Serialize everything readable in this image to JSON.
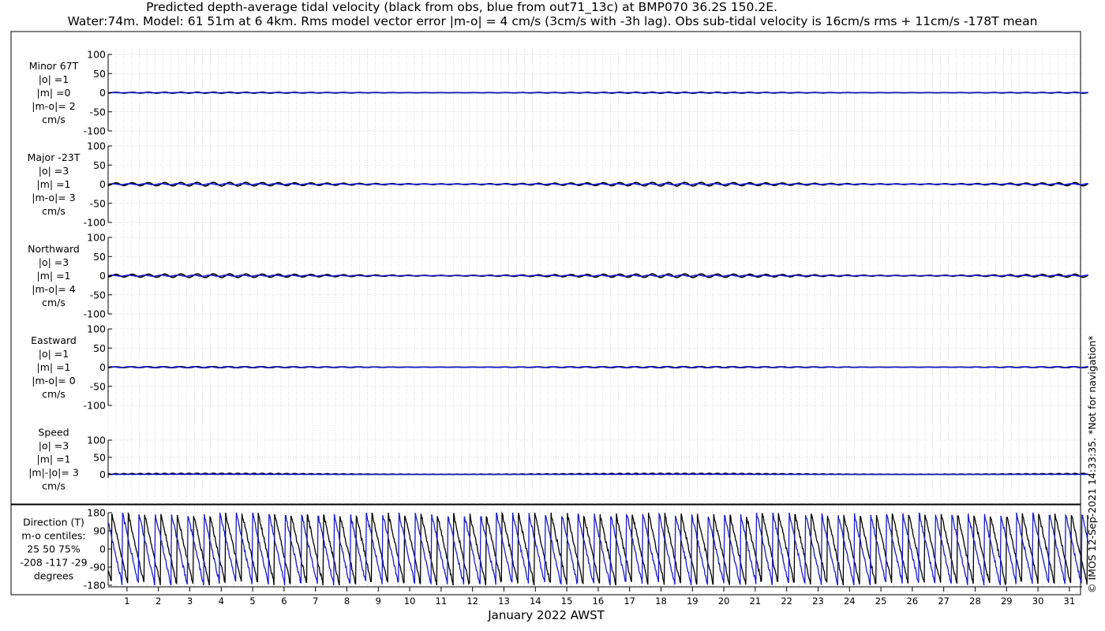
{
  "title_line1": "Predicted depth-average tidal velocity (black from obs, blue from out71_13c) at BMP070 36.2S 150.2E.",
  "title_line2": "Water:74m. Model: 61 51m at 6 4km. Rms model vector error |m-o| = 4 cm/s (3cm/s with -3h lag). Obs sub-tidal velocity is 16cm/s rms + 11cm/s -178T mean",
  "xlabel": "January 2022 AWST",
  "copyright": "© IMOS 12-Sep-2021 14:33:35. *Not for navigation*",
  "colors": {
    "obs": "#000000",
    "model": "#1a1acc",
    "grid": "#bbbbbb",
    "axis": "#000000"
  },
  "chart_data": {
    "type": "line",
    "x_days": [
      "1",
      "2",
      "3",
      "4",
      "5",
      "6",
      "7",
      "8",
      "9",
      "10",
      "11",
      "12",
      "13",
      "14",
      "15",
      "16",
      "17",
      "18",
      "19",
      "20",
      "21",
      "22",
      "23",
      "24",
      "25",
      "26",
      "27",
      "28",
      "29",
      "30",
      "31"
    ],
    "series_legend": [
      "obs (black)",
      "model (blue)"
    ],
    "panels": [
      {
        "id": "minor",
        "label_lines": [
          "Minor 67T",
          "|o| =1",
          "|m| =0",
          "|m-o|= 2",
          "cm/s"
        ],
        "yticks": [
          "100",
          "50",
          "0",
          "-50",
          "-100"
        ],
        "ylim": [
          -100,
          100
        ],
        "obs_amplitude": 1,
        "model_amplitude": 0
      },
      {
        "id": "major",
        "label_lines": [
          "Major -23T",
          "|o| =3",
          "|m| =1",
          "|m-o|= 3",
          "cm/s"
        ],
        "yticks": [
          "100",
          "50",
          "0",
          "-50",
          "-100"
        ],
        "ylim": [
          -100,
          100
        ],
        "obs_amplitude": 3,
        "model_amplitude": 1
      },
      {
        "id": "northward",
        "label_lines": [
          "Northward",
          "|o| =3",
          "|m| =1",
          "|m-o|= 4",
          "cm/s"
        ],
        "yticks": [
          "100",
          "50",
          "0",
          "-50",
          "-100"
        ],
        "ylim": [
          -100,
          100
        ],
        "obs_amplitude": 3,
        "model_amplitude": 1
      },
      {
        "id": "eastward",
        "label_lines": [
          "Eastward",
          "|o| =1",
          "|m| =1",
          "|m-o|= 0",
          "cm/s"
        ],
        "yticks": [
          "100",
          "50",
          "0",
          "-50",
          "-100"
        ],
        "ylim": [
          -100,
          100
        ],
        "obs_amplitude": 1,
        "model_amplitude": 1
      },
      {
        "id": "speed",
        "label_lines": [
          "Speed",
          "|o| =3",
          "|m| =1",
          "|m|-|o|= 3",
          "cm/s"
        ],
        "yticks": [
          "100",
          "50",
          "0"
        ],
        "ylim": [
          -10,
          100
        ],
        "obs_amplitude": 3,
        "model_amplitude": 1
      },
      {
        "id": "direction",
        "label_lines": [
          "Direction (T)",
          "m-o centiles:",
          "25  50  75%",
          "-208 -117  -29",
          "degrees"
        ],
        "yticks": [
          "180",
          "90",
          "0",
          "-90",
          "-180"
        ],
        "ylim": [
          -180,
          180
        ]
      }
    ]
  }
}
